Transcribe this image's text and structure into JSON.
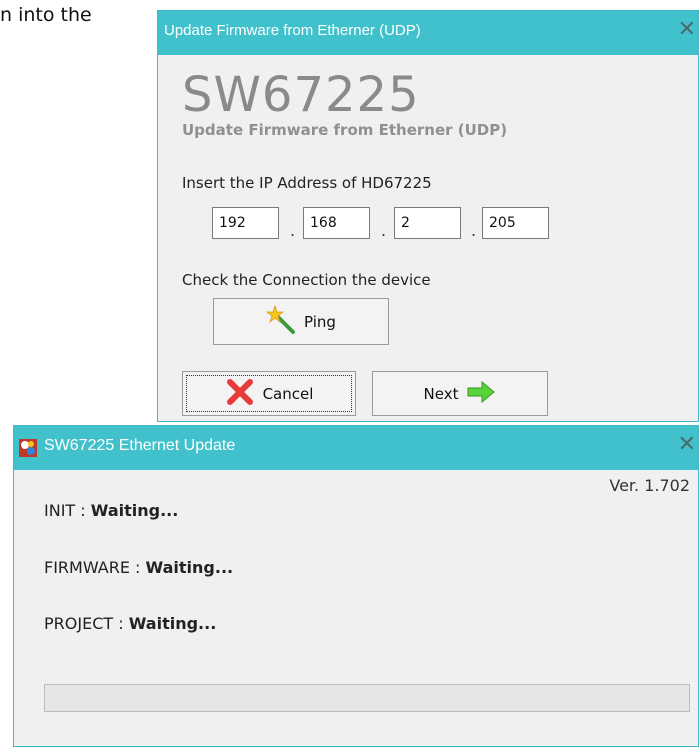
{
  "background_text": "n into the",
  "firmware_dialog": {
    "title": "Update Firmware from Etherner (UDP)",
    "close_glyph": "✕",
    "heading": "SW67225",
    "subheading": "Update Firmware from Etherner (UDP)",
    "ip_label": "Insert the IP Address of  HD67225",
    "ip": [
      "192",
      "168",
      "2",
      "205"
    ],
    "ip_separator": ".",
    "check_label": "Check the Connection the device",
    "ping_button": "Ping",
    "cancel_button": "Cancel",
    "next_button": "Next",
    "icons": {
      "ping": "magic-wand-icon",
      "cancel": "red-x-icon",
      "next": "green-arrow-icon"
    },
    "colors": {
      "titlebar": "#41c1cc",
      "cancel_x": "#e83a3a",
      "next_arrow": "#5ad13a"
    }
  },
  "update_window": {
    "title": "SW67225 Ethernet Update",
    "close_glyph": "✕",
    "version": "Ver. 1.702",
    "status": [
      {
        "label": "INIT :",
        "value": "Waiting..."
      },
      {
        "label": "FIRMWARE :",
        "value": "Waiting..."
      },
      {
        "label": "PROJECT :",
        "value": "Waiting..."
      }
    ],
    "progress": 0,
    "icons": {
      "app": "app-logo-icon"
    },
    "colors": {
      "titlebar": "#41c1cc"
    }
  }
}
